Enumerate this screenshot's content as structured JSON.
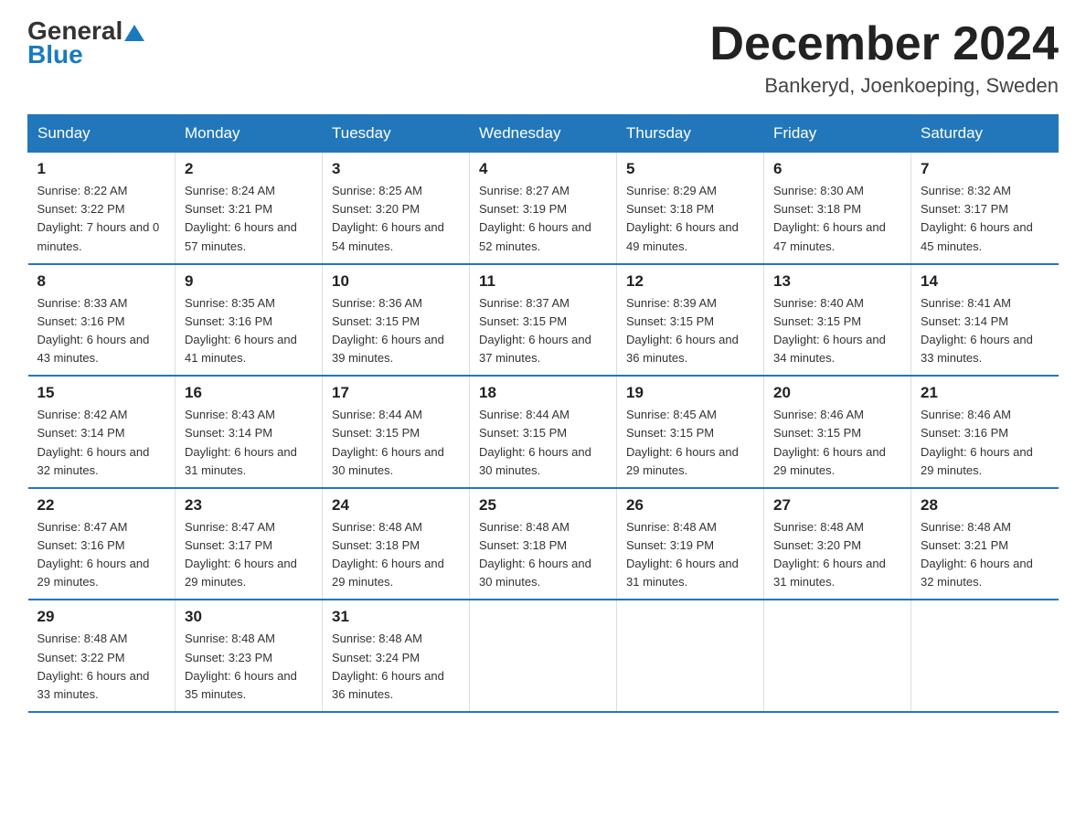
{
  "header": {
    "logo_general": "General",
    "logo_blue": "Blue",
    "month_title": "December 2024",
    "location": "Bankeryd, Joenkoeping, Sweden"
  },
  "weekdays": [
    "Sunday",
    "Monday",
    "Tuesday",
    "Wednesday",
    "Thursday",
    "Friday",
    "Saturday"
  ],
  "weeks": [
    [
      {
        "day": "1",
        "sunrise": "8:22 AM",
        "sunset": "3:22 PM",
        "daylight": "7 hours and 0 minutes."
      },
      {
        "day": "2",
        "sunrise": "8:24 AM",
        "sunset": "3:21 PM",
        "daylight": "6 hours and 57 minutes."
      },
      {
        "day": "3",
        "sunrise": "8:25 AM",
        "sunset": "3:20 PM",
        "daylight": "6 hours and 54 minutes."
      },
      {
        "day": "4",
        "sunrise": "8:27 AM",
        "sunset": "3:19 PM",
        "daylight": "6 hours and 52 minutes."
      },
      {
        "day": "5",
        "sunrise": "8:29 AM",
        "sunset": "3:18 PM",
        "daylight": "6 hours and 49 minutes."
      },
      {
        "day": "6",
        "sunrise": "8:30 AM",
        "sunset": "3:18 PM",
        "daylight": "6 hours and 47 minutes."
      },
      {
        "day": "7",
        "sunrise": "8:32 AM",
        "sunset": "3:17 PM",
        "daylight": "6 hours and 45 minutes."
      }
    ],
    [
      {
        "day": "8",
        "sunrise": "8:33 AM",
        "sunset": "3:16 PM",
        "daylight": "6 hours and 43 minutes."
      },
      {
        "day": "9",
        "sunrise": "8:35 AM",
        "sunset": "3:16 PM",
        "daylight": "6 hours and 41 minutes."
      },
      {
        "day": "10",
        "sunrise": "8:36 AM",
        "sunset": "3:15 PM",
        "daylight": "6 hours and 39 minutes."
      },
      {
        "day": "11",
        "sunrise": "8:37 AM",
        "sunset": "3:15 PM",
        "daylight": "6 hours and 37 minutes."
      },
      {
        "day": "12",
        "sunrise": "8:39 AM",
        "sunset": "3:15 PM",
        "daylight": "6 hours and 36 minutes."
      },
      {
        "day": "13",
        "sunrise": "8:40 AM",
        "sunset": "3:15 PM",
        "daylight": "6 hours and 34 minutes."
      },
      {
        "day": "14",
        "sunrise": "8:41 AM",
        "sunset": "3:14 PM",
        "daylight": "6 hours and 33 minutes."
      }
    ],
    [
      {
        "day": "15",
        "sunrise": "8:42 AM",
        "sunset": "3:14 PM",
        "daylight": "6 hours and 32 minutes."
      },
      {
        "day": "16",
        "sunrise": "8:43 AM",
        "sunset": "3:14 PM",
        "daylight": "6 hours and 31 minutes."
      },
      {
        "day": "17",
        "sunrise": "8:44 AM",
        "sunset": "3:15 PM",
        "daylight": "6 hours and 30 minutes."
      },
      {
        "day": "18",
        "sunrise": "8:44 AM",
        "sunset": "3:15 PM",
        "daylight": "6 hours and 30 minutes."
      },
      {
        "day": "19",
        "sunrise": "8:45 AM",
        "sunset": "3:15 PM",
        "daylight": "6 hours and 29 minutes."
      },
      {
        "day": "20",
        "sunrise": "8:46 AM",
        "sunset": "3:15 PM",
        "daylight": "6 hours and 29 minutes."
      },
      {
        "day": "21",
        "sunrise": "8:46 AM",
        "sunset": "3:16 PM",
        "daylight": "6 hours and 29 minutes."
      }
    ],
    [
      {
        "day": "22",
        "sunrise": "8:47 AM",
        "sunset": "3:16 PM",
        "daylight": "6 hours and 29 minutes."
      },
      {
        "day": "23",
        "sunrise": "8:47 AM",
        "sunset": "3:17 PM",
        "daylight": "6 hours and 29 minutes."
      },
      {
        "day": "24",
        "sunrise": "8:48 AM",
        "sunset": "3:18 PM",
        "daylight": "6 hours and 29 minutes."
      },
      {
        "day": "25",
        "sunrise": "8:48 AM",
        "sunset": "3:18 PM",
        "daylight": "6 hours and 30 minutes."
      },
      {
        "day": "26",
        "sunrise": "8:48 AM",
        "sunset": "3:19 PM",
        "daylight": "6 hours and 31 minutes."
      },
      {
        "day": "27",
        "sunrise": "8:48 AM",
        "sunset": "3:20 PM",
        "daylight": "6 hours and 31 minutes."
      },
      {
        "day": "28",
        "sunrise": "8:48 AM",
        "sunset": "3:21 PM",
        "daylight": "6 hours and 32 minutes."
      }
    ],
    [
      {
        "day": "29",
        "sunrise": "8:48 AM",
        "sunset": "3:22 PM",
        "daylight": "6 hours and 33 minutes."
      },
      {
        "day": "30",
        "sunrise": "8:48 AM",
        "sunset": "3:23 PM",
        "daylight": "6 hours and 35 minutes."
      },
      {
        "day": "31",
        "sunrise": "8:48 AM",
        "sunset": "3:24 PM",
        "daylight": "6 hours and 36 minutes."
      },
      null,
      null,
      null,
      null
    ]
  ]
}
